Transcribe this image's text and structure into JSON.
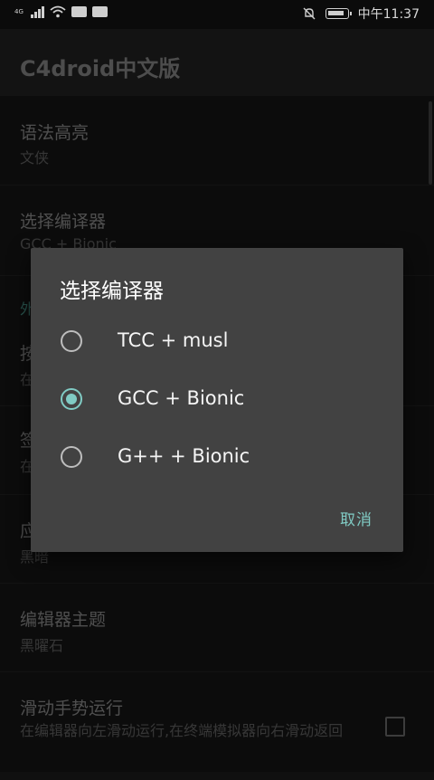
{
  "status_bar": {
    "network": "4G",
    "time": "中午11:37"
  },
  "app": {
    "title": "C4droid中文版"
  },
  "settings": {
    "syntax": {
      "title": "语法高亮",
      "value": "文侠"
    },
    "compiler": {
      "title": "选择编译器",
      "value": "GCC + Bionic"
    },
    "section_partial": "外",
    "row3_title": "按",
    "row3_sub": "在",
    "row4_title": "签",
    "row4_sub": "在",
    "row5_title": "应",
    "row5_sub": "黑暗",
    "editor_theme": {
      "title": "编辑器主题",
      "value": "黑曜石"
    },
    "swipe_run": {
      "title": "滑动手势运行",
      "desc": "在编辑器向左滑动运行,在终端模拟器向右滑动返回"
    }
  },
  "dialog": {
    "title": "选择编译器",
    "options": [
      {
        "label": "TCC + musl",
        "selected": false
      },
      {
        "label": "GCC + Bionic",
        "selected": true
      },
      {
        "label": "G++ + Bionic",
        "selected": false
      }
    ],
    "cancel_label": "取消"
  },
  "colors": {
    "accent": "#80cbc4",
    "dialog_bg": "#424242"
  }
}
